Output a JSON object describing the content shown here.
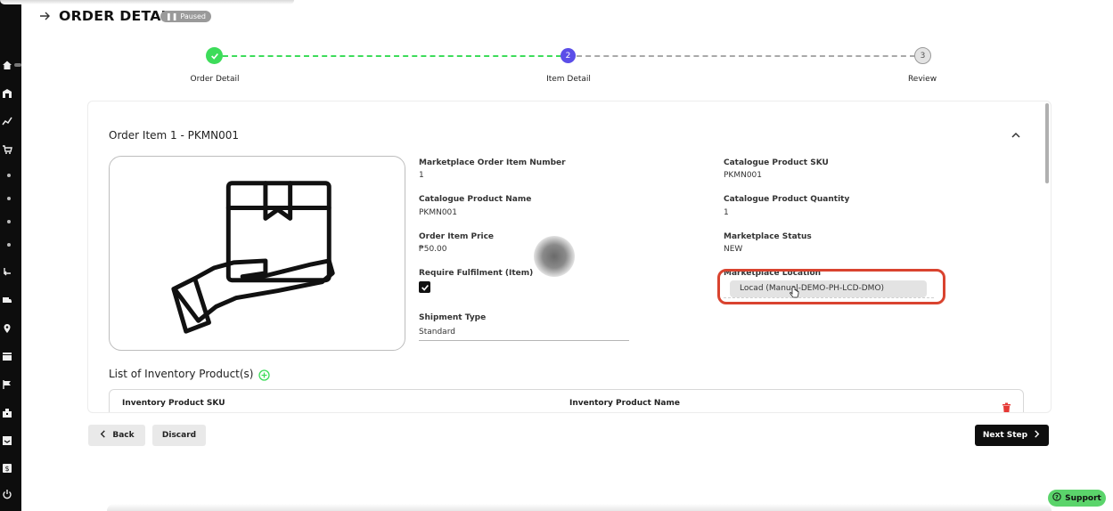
{
  "header": {
    "title": "ORDER DETAIL",
    "status": "Paused"
  },
  "stepper": {
    "steps": [
      {
        "number": "",
        "label": "Order Detail",
        "state": "completed"
      },
      {
        "number": "2",
        "label": "Item Detail",
        "state": "active"
      },
      {
        "number": "3",
        "label": "Review",
        "state": "pending"
      }
    ]
  },
  "card": {
    "title": "Order Item 1 - PKMN001",
    "fields": {
      "marketplace_order_item_number": {
        "label": "Marketplace Order Item Number",
        "value": "1"
      },
      "catalogue_product_sku": {
        "label": "Catalogue Product SKU",
        "value": "PKMN001"
      },
      "catalogue_product_name": {
        "label": "Catalogue Product Name",
        "value": "PKMN001"
      },
      "catalogue_product_quantity": {
        "label": "Catalogue Product Quantity",
        "value": "1"
      },
      "order_item_price": {
        "label": "Order Item Price",
        "value": "₱50.00"
      },
      "marketplace_status": {
        "label": "Marketplace Status",
        "value": "NEW"
      },
      "require_fulfilment": {
        "label": "Require Fulfilment (Item)",
        "checked": true
      },
      "marketplace_location": {
        "label": "Marketplace Location",
        "value": "Locad (Manual-DEMO-PH-LCD-DMO)"
      },
      "shipment_type": {
        "label": "Shipment Type",
        "value": "Standard"
      }
    },
    "inventory": {
      "title": "List of Inventory Product(s)",
      "columns": [
        "Inventory Product SKU",
        "Inventory Product Name"
      ]
    }
  },
  "footer": {
    "back_label": "Back",
    "discard_label": "Discard",
    "next_label": "Next Step"
  },
  "support_label": "Support",
  "colors": {
    "accent_green": "#3ddc5a",
    "active_step": "#5b4ee8",
    "highlight_red": "#d9432f",
    "delete_red": "#e53935"
  }
}
